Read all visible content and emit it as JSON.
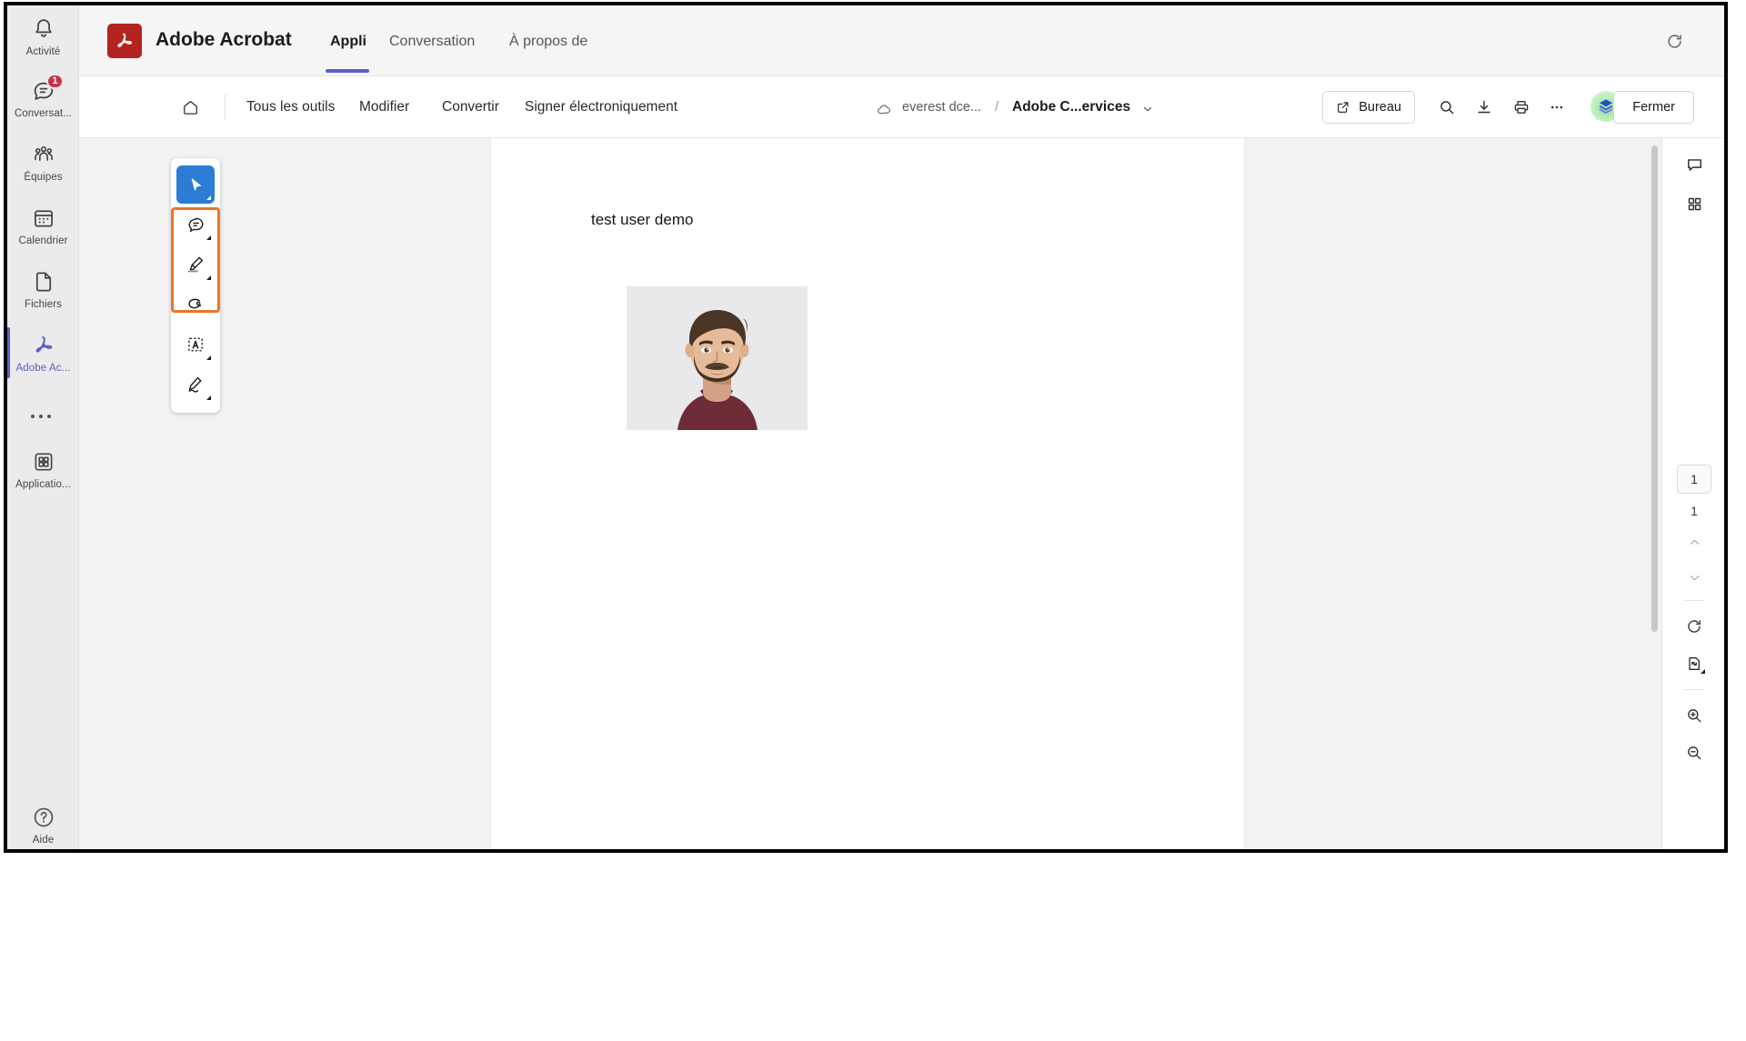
{
  "rail": {
    "items": [
      {
        "label": "Activité",
        "icon": "bell-icon",
        "badge": null,
        "active": false
      },
      {
        "label": "Conversat...",
        "icon": "chat-icon",
        "badge": "1",
        "active": false
      },
      {
        "label": "Équipes",
        "icon": "teams-icon",
        "badge": null,
        "active": false
      },
      {
        "label": "Calendrier",
        "icon": "calendar-icon",
        "badge": null,
        "active": false
      },
      {
        "label": "Fichiers",
        "icon": "file-icon",
        "badge": null,
        "active": false
      },
      {
        "label": "Adobe Ac...",
        "icon": "adobe-acrobat-icon",
        "badge": null,
        "active": true
      },
      {
        "label": "",
        "icon": "more-options-icon",
        "badge": null,
        "active": false
      },
      {
        "label": "Applicatio...",
        "icon": "apps-grid-icon",
        "badge": null,
        "active": false
      }
    ],
    "help": {
      "label": "Aide",
      "icon": "help-circle-icon"
    }
  },
  "header": {
    "app_title": "Adobe Acrobat",
    "logo_icon": "adobe-acrobat-logo",
    "tabs": [
      {
        "label": "Appli",
        "selected": true
      },
      {
        "label": "Conversation",
        "selected": false
      },
      {
        "label": "À propos de",
        "selected": false
      }
    ],
    "refresh_icon": "refresh-icon",
    "accent_color": "#5b5fc7"
  },
  "toolbar": {
    "home_icon": "home-icon",
    "menus": [
      {
        "label": "Tous les outils"
      },
      {
        "label": "Modifier"
      },
      {
        "label": "Convertir"
      },
      {
        "label": "Signer électroniquement"
      }
    ],
    "breadcrumb": {
      "cloud_icon": "cloud-icon",
      "cloud_label": "everest dce...",
      "separator": "/",
      "document_title": "Adobe C...ervices",
      "caret_icon": "chevron-down-icon"
    },
    "desktop_button": {
      "label": "Bureau",
      "icon": "open-external-icon"
    },
    "actions": [
      {
        "icon": "search-icon",
        "name": "search-button"
      },
      {
        "icon": "download-icon",
        "name": "download-button"
      },
      {
        "icon": "print-icon",
        "name": "print-button"
      },
      {
        "icon": "more-horizontal-icon",
        "name": "more-button"
      }
    ],
    "avatar": {
      "icon": "user-avatar"
    },
    "close_button": {
      "label": "Fermer"
    }
  },
  "tool_palette": {
    "tools": [
      {
        "name": "select-tool",
        "icon": "cursor-arrow-icon",
        "active": true,
        "has_caret": true
      },
      {
        "name": "comment-tool",
        "icon": "comment-bubble-icon",
        "active": false,
        "has_caret": true
      },
      {
        "name": "highlight-tool",
        "icon": "highlighter-pen-icon",
        "active": false,
        "has_caret": true
      },
      {
        "name": "draw-tool",
        "icon": "lasso-draw-icon",
        "active": false,
        "has_caret": false
      },
      {
        "name": "text-box-tool",
        "icon": "add-text-box-icon",
        "active": false,
        "has_caret": true
      },
      {
        "name": "sign-tool",
        "icon": "sign-pen-icon",
        "active": false,
        "has_caret": true
      }
    ],
    "highlight_outline_color": "#e8762a"
  },
  "document": {
    "text": "test user demo",
    "photo_alt": "portrait-photo"
  },
  "right_panel": {
    "top_buttons": [
      {
        "name": "comments-panel-button",
        "icon": "comment-panel-icon"
      },
      {
        "name": "thumbnails-panel-button",
        "icon": "grid-thumbnails-icon"
      }
    ],
    "page_current": "1",
    "page_total": "1",
    "nav": [
      {
        "name": "previous-page-button",
        "icon": "chevron-up-icon"
      },
      {
        "name": "next-page-button",
        "icon": "chevron-down-icon"
      }
    ],
    "tools": [
      {
        "name": "rotate-button",
        "icon": "rotate-clockwise-icon"
      },
      {
        "name": "fit-page-button",
        "icon": "fit-page-icon"
      },
      {
        "name": "zoom-in-button",
        "icon": "zoom-in-icon"
      },
      {
        "name": "zoom-out-button",
        "icon": "zoom-out-icon"
      }
    ]
  }
}
